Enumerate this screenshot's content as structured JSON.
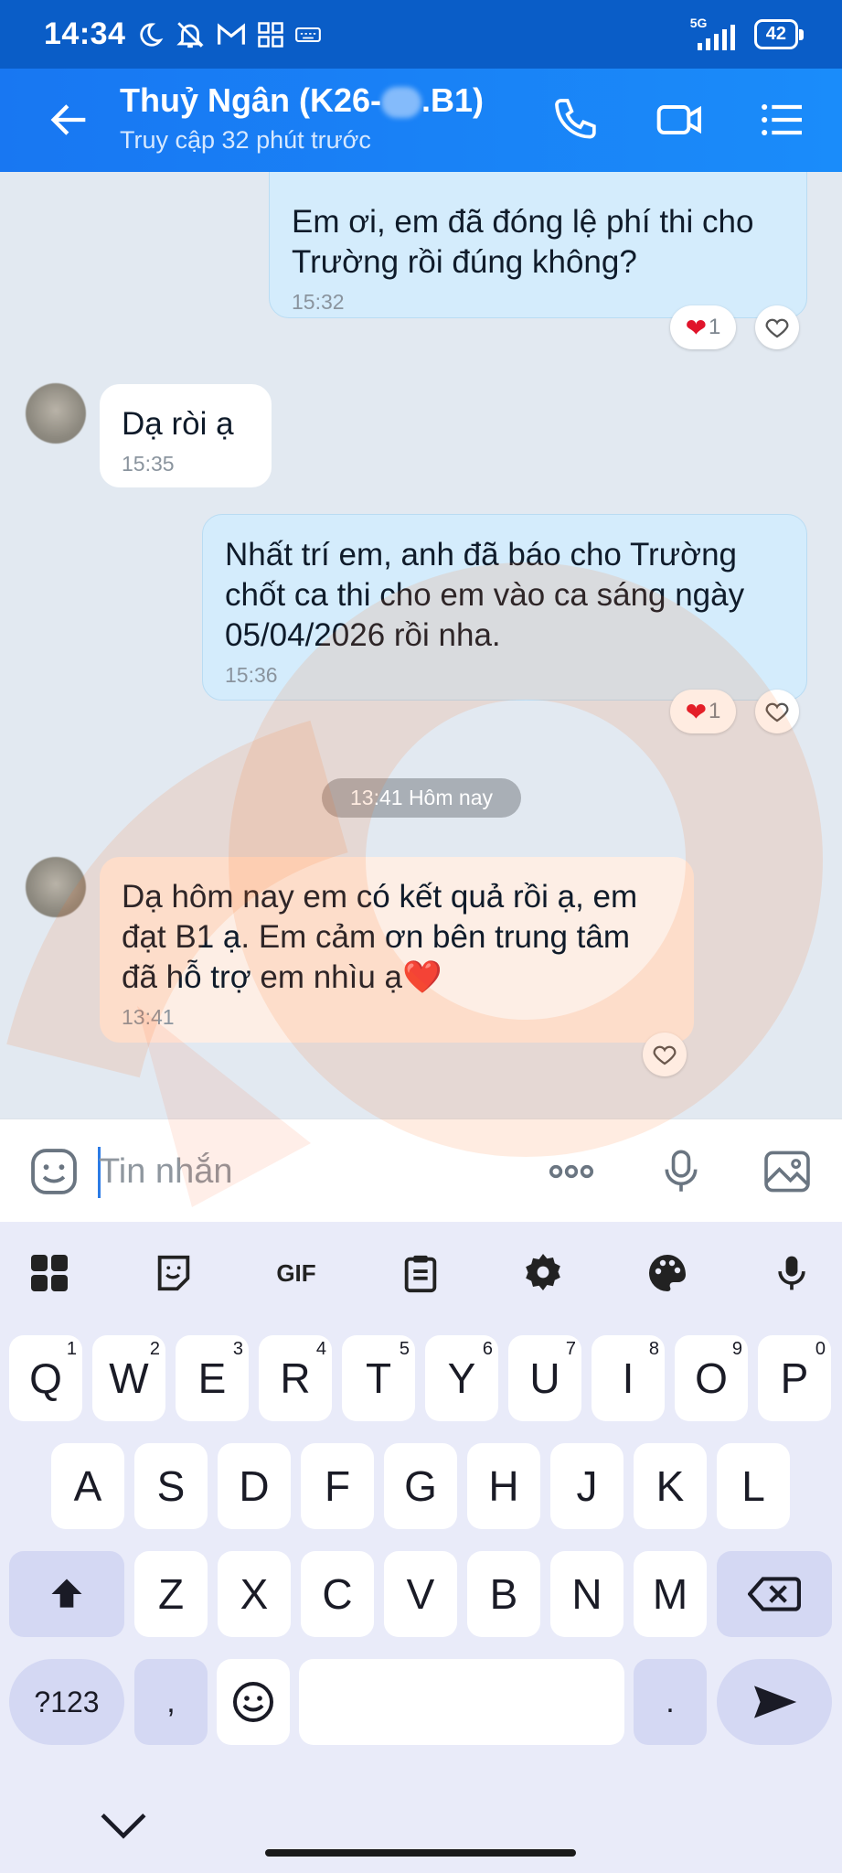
{
  "status_bar": {
    "time": "14:34",
    "network": "5G",
    "battery": "42"
  },
  "header": {
    "contact_name": "Thuỷ Ngân (K26-",
    "contact_name_suffix": ".B1)",
    "last_seen": "Truy cập 32 phút trước"
  },
  "messages": [
    {
      "text": "Em ơi, em đã đóng lệ phí thi cho Trường rồi đúng không?",
      "time": "15:32",
      "reaction_count": "1"
    },
    {
      "text": "Dạ ròi ạ",
      "time": "15:35"
    },
    {
      "text": "Nhất trí em, anh đã báo cho Trường chốt ca thi cho em vào ca sáng ngày 05/04/2026 rồi nha.",
      "time": "15:36",
      "reaction_count": "1"
    },
    {
      "text": "Dạ hôm nay em có kết quả rồi ạ, em đạt B1 ạ. Em cảm ơn bên trung tâm đã hỗ trợ em nhìu ạ❤️",
      "time": "13:41"
    }
  ],
  "date_separator": "13:41 Hôm nay",
  "input": {
    "placeholder": "Tin nhắn"
  },
  "keyboard": {
    "toolbar_gif": "GIF",
    "row1": [
      "Q",
      "W",
      "E",
      "R",
      "T",
      "Y",
      "U",
      "I",
      "O",
      "P"
    ],
    "row1_sup": [
      "1",
      "2",
      "3",
      "4",
      "5",
      "6",
      "7",
      "8",
      "9",
      "0"
    ],
    "row2": [
      "A",
      "S",
      "D",
      "F",
      "G",
      "H",
      "J",
      "K",
      "L"
    ],
    "row3": [
      "Z",
      "X",
      "C",
      "V",
      "B",
      "N",
      "M"
    ],
    "symbols": "?123",
    "comma": ",",
    "period": "."
  },
  "colors": {
    "header": "#1877f2",
    "status_bar": "#0a5dc7",
    "out_bubble": "#d4ecfc",
    "accent": "#2c7be5"
  }
}
